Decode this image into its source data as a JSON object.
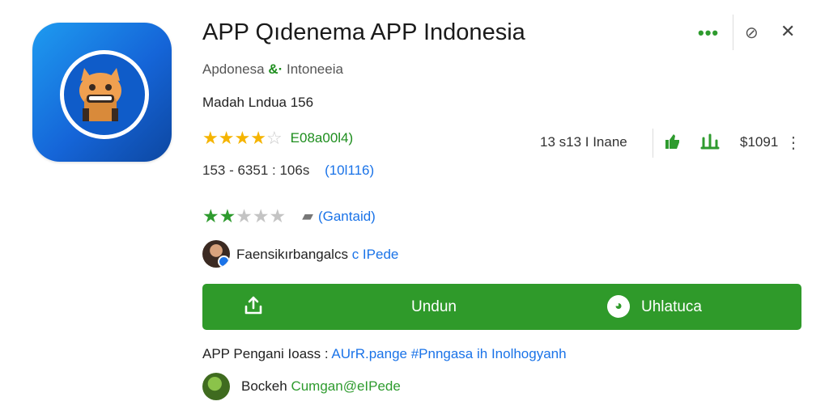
{
  "app": {
    "title": "APP Qıdenema APP Indonesia",
    "developer": "Apdonesa",
    "developer_amp": "&·",
    "developer_suffix": "Intoneeia",
    "size_label": "Madah Lndua 156",
    "rating_stars": 4.5,
    "rating_text": "E08a00l4)",
    "meta": "153 - 6351 : 106s",
    "meta_link": "(10l116)",
    "review_stars": 2.5,
    "content_link": "(Gantaid)"
  },
  "header_actions": {
    "more_label": "•••",
    "link_icon": "⊘",
    "close_icon": "✕"
  },
  "stats": {
    "downloads": "13 s13 I Inane",
    "price": "$1091"
  },
  "reviewer1": {
    "text": "Faensikırbangalcs",
    "link": "c IPede"
  },
  "actions": {
    "download_label": "Undun",
    "chat_label": "Uhlatuca"
  },
  "description": {
    "prefix": "APP Pengani Ioass :",
    "link": "AUrR.pange #Pnngasa ih Inolhogyanh"
  },
  "reviewer2": {
    "name": "Bockeh",
    "handle": "Cumgan@eIPede"
  },
  "colors": {
    "accent_green": "#2f9a2a",
    "link_blue": "#1a73e8",
    "star_gold": "#f5b400",
    "icon_blue": "#1565d8"
  }
}
